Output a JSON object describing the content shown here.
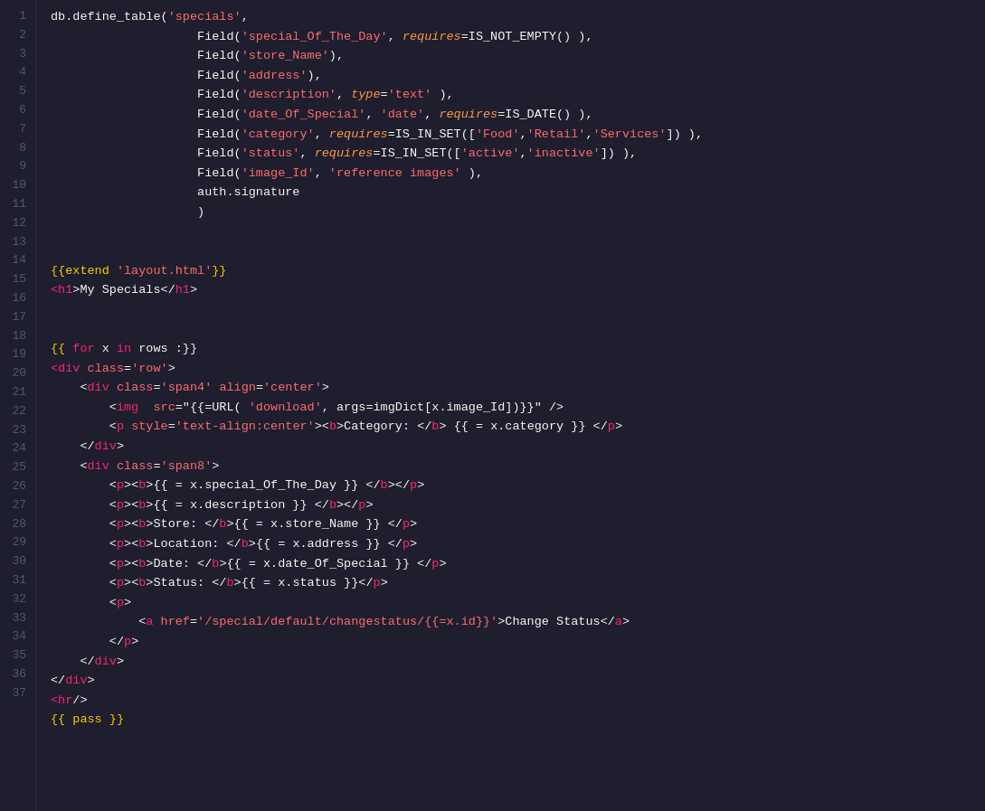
{
  "editor": {
    "background": "#1e1e2e",
    "line_number_color": "#555577"
  },
  "lines": [
    {
      "num": 1,
      "tokens": [
        {
          "t": "db.define_table(",
          "c": "c-white"
        },
        {
          "t": "'specials'",
          "c": "c-string"
        },
        {
          "t": ",",
          "c": "c-white"
        }
      ]
    },
    {
      "num": 2,
      "tokens": [
        {
          "t": "                    Field(",
          "c": "c-white"
        },
        {
          "t": "'special_Of_The_Day'",
          "c": "c-string"
        },
        {
          "t": ", ",
          "c": "c-white"
        },
        {
          "t": "requires",
          "c": "c-italic-orange"
        },
        {
          "t": "=IS_NOT_EMPTY() ),",
          "c": "c-white"
        }
      ]
    },
    {
      "num": 3,
      "tokens": [
        {
          "t": "                    Field(",
          "c": "c-white"
        },
        {
          "t": "'store_Name'",
          "c": "c-string"
        },
        {
          "t": "),",
          "c": "c-white"
        }
      ]
    },
    {
      "num": 4,
      "tokens": [
        {
          "t": "                    Field(",
          "c": "c-white"
        },
        {
          "t": "'address'",
          "c": "c-string"
        },
        {
          "t": "),",
          "c": "c-white"
        }
      ]
    },
    {
      "num": 5,
      "tokens": [
        {
          "t": "                    Field(",
          "c": "c-white"
        },
        {
          "t": "'description'",
          "c": "c-string"
        },
        {
          "t": ", ",
          "c": "c-white"
        },
        {
          "t": "type",
          "c": "c-italic-orange"
        },
        {
          "t": "=",
          "c": "c-white"
        },
        {
          "t": "'text'",
          "c": "c-string"
        },
        {
          "t": " ),",
          "c": "c-white"
        }
      ]
    },
    {
      "num": 6,
      "tokens": [
        {
          "t": "                    Field(",
          "c": "c-white"
        },
        {
          "t": "'date_Of_Special'",
          "c": "c-string"
        },
        {
          "t": ", ",
          "c": "c-white"
        },
        {
          "t": "'date'",
          "c": "c-string"
        },
        {
          "t": ", ",
          "c": "c-white"
        },
        {
          "t": "requires",
          "c": "c-italic-orange"
        },
        {
          "t": "=IS_DATE() ),",
          "c": "c-white"
        }
      ]
    },
    {
      "num": 7,
      "tokens": [
        {
          "t": "                    Field(",
          "c": "c-white"
        },
        {
          "t": "'category'",
          "c": "c-string"
        },
        {
          "t": ", ",
          "c": "c-white"
        },
        {
          "t": "requires",
          "c": "c-italic-orange"
        },
        {
          "t": "=IS_IN_SET([",
          "c": "c-white"
        },
        {
          "t": "'Food'",
          "c": "c-string"
        },
        {
          "t": ",",
          "c": "c-white"
        },
        {
          "t": "'Retail'",
          "c": "c-string"
        },
        {
          "t": ",",
          "c": "c-white"
        },
        {
          "t": "'Services'",
          "c": "c-string"
        },
        {
          "t": "]) ),",
          "c": "c-white"
        }
      ]
    },
    {
      "num": 8,
      "tokens": [
        {
          "t": "                    Field(",
          "c": "c-white"
        },
        {
          "t": "'status'",
          "c": "c-string"
        },
        {
          "t": ", ",
          "c": "c-white"
        },
        {
          "t": "requires",
          "c": "c-italic-orange"
        },
        {
          "t": "=IS_IN_SET([",
          "c": "c-white"
        },
        {
          "t": "'active'",
          "c": "c-string"
        },
        {
          "t": ",",
          "c": "c-white"
        },
        {
          "t": "'inactive'",
          "c": "c-string"
        },
        {
          "t": "]) ),",
          "c": "c-white"
        }
      ]
    },
    {
      "num": 9,
      "tokens": [
        {
          "t": "                    Field(",
          "c": "c-white"
        },
        {
          "t": "'image_Id'",
          "c": "c-string"
        },
        {
          "t": ", ",
          "c": "c-white"
        },
        {
          "t": "'reference images'",
          "c": "c-string"
        },
        {
          "t": " ),",
          "c": "c-white"
        }
      ]
    },
    {
      "num": 10,
      "tokens": [
        {
          "t": "                    auth.signature",
          "c": "c-white"
        }
      ]
    },
    {
      "num": 11,
      "tokens": [
        {
          "t": "                    )",
          "c": "c-white"
        }
      ]
    },
    {
      "num": 12,
      "tokens": []
    },
    {
      "num": 13,
      "tokens": []
    },
    {
      "num": 14,
      "tokens": [
        {
          "t": "{{extend ",
          "c": "c-template"
        },
        {
          "t": "'layout.html'",
          "c": "c-string"
        },
        {
          "t": "}}",
          "c": "c-template"
        }
      ]
    },
    {
      "num": 15,
      "tokens": [
        {
          "t": "<",
          "c": "c-tag"
        },
        {
          "t": "h1",
          "c": "c-tag"
        },
        {
          "t": ">My Specials</",
          "c": "c-white"
        },
        {
          "t": "h1",
          "c": "c-tag"
        },
        {
          "t": ">",
          "c": "c-white"
        }
      ]
    },
    {
      "num": 16,
      "tokens": []
    },
    {
      "num": 17,
      "tokens": []
    },
    {
      "num": 18,
      "tokens": [
        {
          "t": "{{ ",
          "c": "c-template"
        },
        {
          "t": "for",
          "c": "c-keyword"
        },
        {
          "t": " x ",
          "c": "c-white"
        },
        {
          "t": "in",
          "c": "c-keyword"
        },
        {
          "t": " rows :}}",
          "c": "c-white"
        }
      ]
    },
    {
      "num": 19,
      "tokens": [
        {
          "t": "<",
          "c": "c-tag"
        },
        {
          "t": "div",
          "c": "c-tag"
        },
        {
          "t": " ",
          "c": "c-white"
        },
        {
          "t": "class",
          "c": "c-attr"
        },
        {
          "t": "=",
          "c": "c-white"
        },
        {
          "t": "'row'",
          "c": "c-string"
        },
        {
          "t": ">",
          "c": "c-white"
        }
      ]
    },
    {
      "num": 20,
      "tokens": [
        {
          "t": "    <",
          "c": "c-white"
        },
        {
          "t": "div",
          "c": "c-tag"
        },
        {
          "t": " ",
          "c": "c-white"
        },
        {
          "t": "class",
          "c": "c-attr"
        },
        {
          "t": "=",
          "c": "c-white"
        },
        {
          "t": "'span4'",
          "c": "c-string"
        },
        {
          "t": " ",
          "c": "c-white"
        },
        {
          "t": "align",
          "c": "c-attr"
        },
        {
          "t": "=",
          "c": "c-white"
        },
        {
          "t": "'center'",
          "c": "c-string"
        },
        {
          "t": ">",
          "c": "c-white"
        }
      ]
    },
    {
      "num": 21,
      "tokens": [
        {
          "t": "        <",
          "c": "c-white"
        },
        {
          "t": "img",
          "c": "c-tag"
        },
        {
          "t": "  ",
          "c": "c-white"
        },
        {
          "t": "src",
          "c": "c-attr"
        },
        {
          "t": "=\"{{=URL( ",
          "c": "c-white"
        },
        {
          "t": "'download'",
          "c": "c-string"
        },
        {
          "t": ", args=imgDict[x.image_Id])}}\" />",
          "c": "c-white"
        }
      ]
    },
    {
      "num": 22,
      "tokens": [
        {
          "t": "        <",
          "c": "c-white"
        },
        {
          "t": "p",
          "c": "c-tag"
        },
        {
          "t": " ",
          "c": "c-white"
        },
        {
          "t": "style",
          "c": "c-attr"
        },
        {
          "t": "=",
          "c": "c-white"
        },
        {
          "t": "'text-align:center'",
          "c": "c-string"
        },
        {
          "t": "><",
          "c": "c-white"
        },
        {
          "t": "b",
          "c": "c-tag"
        },
        {
          "t": ">Category: </",
          "c": "c-white"
        },
        {
          "t": "b",
          "c": "c-tag"
        },
        {
          "t": "> {{ = x.category }} </",
          "c": "c-white"
        },
        {
          "t": "p",
          "c": "c-tag"
        },
        {
          "t": ">",
          "c": "c-white"
        }
      ]
    },
    {
      "num": 23,
      "tokens": [
        {
          "t": "    </",
          "c": "c-white"
        },
        {
          "t": "div",
          "c": "c-tag"
        },
        {
          "t": ">",
          "c": "c-white"
        }
      ]
    },
    {
      "num": 24,
      "tokens": [
        {
          "t": "    <",
          "c": "c-white"
        },
        {
          "t": "div",
          "c": "c-tag"
        },
        {
          "t": " ",
          "c": "c-white"
        },
        {
          "t": "class",
          "c": "c-attr"
        },
        {
          "t": "=",
          "c": "c-white"
        },
        {
          "t": "'span8'",
          "c": "c-string"
        },
        {
          "t": ">",
          "c": "c-white"
        }
      ]
    },
    {
      "num": 25,
      "tokens": [
        {
          "t": "        <",
          "c": "c-white"
        },
        {
          "t": "p",
          "c": "c-tag"
        },
        {
          "t": "><",
          "c": "c-white"
        },
        {
          "t": "b",
          "c": "c-tag"
        },
        {
          "t": ">{{ = x.special_Of_The_Day }} </",
          "c": "c-white"
        },
        {
          "t": "b",
          "c": "c-tag"
        },
        {
          "t": "></",
          "c": "c-white"
        },
        {
          "t": "p",
          "c": "c-tag"
        },
        {
          "t": ">",
          "c": "c-white"
        }
      ]
    },
    {
      "num": 26,
      "tokens": [
        {
          "t": "        <",
          "c": "c-white"
        },
        {
          "t": "p",
          "c": "c-tag"
        },
        {
          "t": "><",
          "c": "c-white"
        },
        {
          "t": "b",
          "c": "c-tag"
        },
        {
          "t": ">{{ = x.description }} </",
          "c": "c-white"
        },
        {
          "t": "b",
          "c": "c-tag"
        },
        {
          "t": "></",
          "c": "c-white"
        },
        {
          "t": "p",
          "c": "c-tag"
        },
        {
          "t": ">",
          "c": "c-white"
        }
      ]
    },
    {
      "num": 27,
      "tokens": [
        {
          "t": "        <",
          "c": "c-white"
        },
        {
          "t": "p",
          "c": "c-tag"
        },
        {
          "t": "><",
          "c": "c-white"
        },
        {
          "t": "b",
          "c": "c-tag"
        },
        {
          "t": ">Store: </",
          "c": "c-white"
        },
        {
          "t": "b",
          "c": "c-tag"
        },
        {
          "t": ">{{ = x.store_Name }} </",
          "c": "c-white"
        },
        {
          "t": "p",
          "c": "c-tag"
        },
        {
          "t": ">",
          "c": "c-white"
        }
      ]
    },
    {
      "num": 28,
      "tokens": [
        {
          "t": "        <",
          "c": "c-white"
        },
        {
          "t": "p",
          "c": "c-tag"
        },
        {
          "t": "><",
          "c": "c-white"
        },
        {
          "t": "b",
          "c": "c-tag"
        },
        {
          "t": ">Location: </",
          "c": "c-white"
        },
        {
          "t": "b",
          "c": "c-tag"
        },
        {
          "t": ">{{ = x.address }} </",
          "c": "c-white"
        },
        {
          "t": "p",
          "c": "c-tag"
        },
        {
          "t": ">",
          "c": "c-white"
        }
      ]
    },
    {
      "num": 29,
      "tokens": [
        {
          "t": "        <",
          "c": "c-white"
        },
        {
          "t": "p",
          "c": "c-tag"
        },
        {
          "t": "><",
          "c": "c-white"
        },
        {
          "t": "b",
          "c": "c-tag"
        },
        {
          "t": ">Date: </",
          "c": "c-white"
        },
        {
          "t": "b",
          "c": "c-tag"
        },
        {
          "t": ">{{ = x.date_Of_Special }} </",
          "c": "c-white"
        },
        {
          "t": "p",
          "c": "c-tag"
        },
        {
          "t": ">",
          "c": "c-white"
        }
      ]
    },
    {
      "num": 30,
      "tokens": [
        {
          "t": "        <",
          "c": "c-white"
        },
        {
          "t": "p",
          "c": "c-tag"
        },
        {
          "t": "><",
          "c": "c-white"
        },
        {
          "t": "b",
          "c": "c-tag"
        },
        {
          "t": ">Status: </",
          "c": "c-white"
        },
        {
          "t": "b",
          "c": "c-tag"
        },
        {
          "t": ">{{ = x.status }}</",
          "c": "c-white"
        },
        {
          "t": "p",
          "c": "c-tag"
        },
        {
          "t": ">",
          "c": "c-white"
        }
      ]
    },
    {
      "num": 31,
      "tokens": [
        {
          "t": "        <",
          "c": "c-white"
        },
        {
          "t": "p",
          "c": "c-tag"
        },
        {
          "t": ">",
          "c": "c-white"
        }
      ]
    },
    {
      "num": 32,
      "tokens": [
        {
          "t": "            <",
          "c": "c-white"
        },
        {
          "t": "a",
          "c": "c-tag"
        },
        {
          "t": " ",
          "c": "c-white"
        },
        {
          "t": "href",
          "c": "c-attr"
        },
        {
          "t": "=",
          "c": "c-white"
        },
        {
          "t": "'/special/default/changestatus/{{=x.id}}'",
          "c": "c-string"
        },
        {
          "t": ">Change Status</",
          "c": "c-white"
        },
        {
          "t": "a",
          "c": "c-tag"
        },
        {
          "t": ">",
          "c": "c-white"
        }
      ]
    },
    {
      "num": 33,
      "tokens": [
        {
          "t": "        </",
          "c": "c-white"
        },
        {
          "t": "p",
          "c": "c-tag"
        },
        {
          "t": ">",
          "c": "c-white"
        }
      ]
    },
    {
      "num": 34,
      "tokens": [
        {
          "t": "    </",
          "c": "c-white"
        },
        {
          "t": "div",
          "c": "c-tag"
        },
        {
          "t": ">",
          "c": "c-white"
        }
      ]
    },
    {
      "num": 35,
      "tokens": [
        {
          "t": "</",
          "c": "c-white"
        },
        {
          "t": "div",
          "c": "c-tag"
        },
        {
          "t": ">",
          "c": "c-white"
        }
      ]
    },
    {
      "num": 36,
      "tokens": [
        {
          "t": "<",
          "c": "c-tag"
        },
        {
          "t": "hr",
          "c": "c-tag"
        },
        {
          "t": "/>",
          "c": "c-white"
        }
      ]
    },
    {
      "num": 37,
      "tokens": [
        {
          "t": "{{ pass }}",
          "c": "c-template"
        }
      ]
    }
  ]
}
